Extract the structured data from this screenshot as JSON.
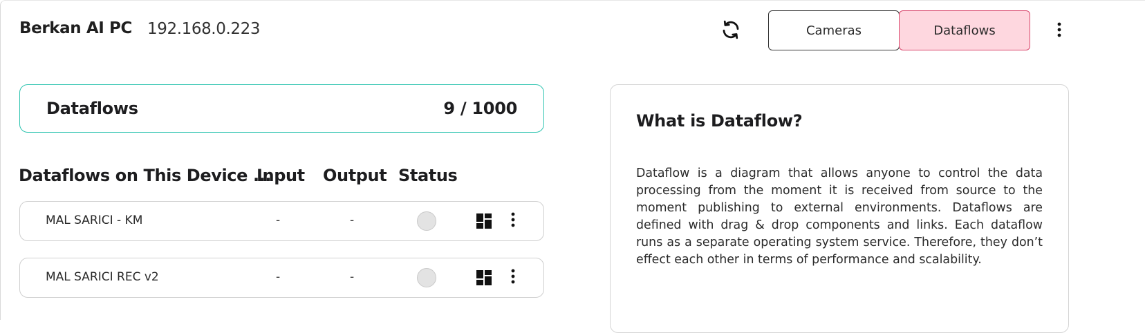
{
  "header": {
    "device_name": "Berkan AI PC",
    "device_ip": "192.168.0.223",
    "refresh_icon": "refresh-icon",
    "tabs": [
      {
        "label": "Cameras",
        "active": false
      },
      {
        "label": "Dataflows",
        "active": true
      }
    ],
    "menu_icon": "more-vertical-icon"
  },
  "summary": {
    "title": "Dataflows",
    "count": "9 / 1000"
  },
  "table": {
    "headers": {
      "name": "Dataflows on This Device ...",
      "input": "Input",
      "output": "Output",
      "status": "Status"
    },
    "rows": [
      {
        "name": "MAL SARICI - KM",
        "input": "-",
        "output": "-",
        "status": "inactive"
      },
      {
        "name": "MAL SARICI REC v2",
        "input": "-",
        "output": "-",
        "status": "inactive"
      }
    ]
  },
  "info": {
    "title": "What is Dataflow?",
    "body": "Dataflow is a diagram that allows anyone to control the data processing from the moment it is received from source to the moment publishing to external environments. Dataflows are defined with drag & drop components and links. Each dataflow runs as a separate operating system service. Therefore, they don’t effect each other in terms of performance and scalability."
  },
  "colors": {
    "accent_teal": "#2ec4b0",
    "active_tab_bg": "#fed7df",
    "active_tab_border": "#d9456b"
  }
}
